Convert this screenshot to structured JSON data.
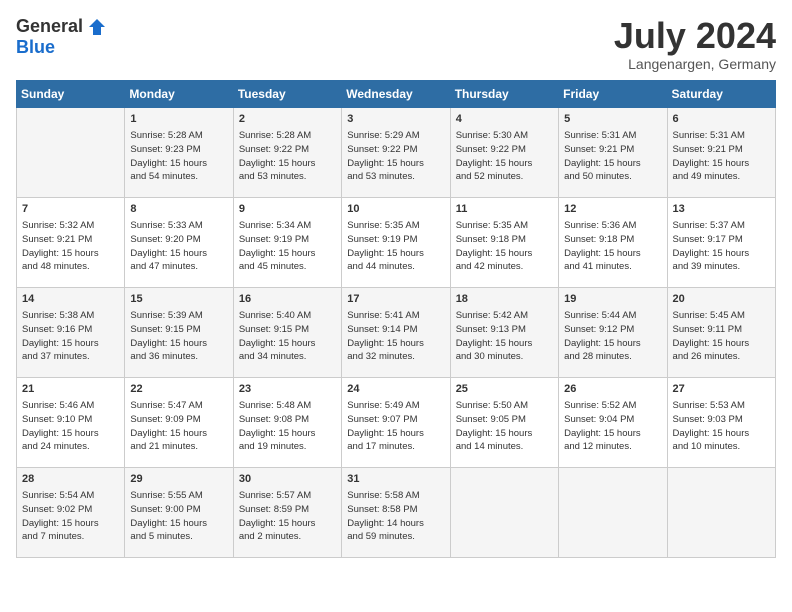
{
  "header": {
    "logo_general": "General",
    "logo_blue": "Blue",
    "month_year": "July 2024",
    "location": "Langenargen, Germany"
  },
  "columns": [
    "Sunday",
    "Monday",
    "Tuesday",
    "Wednesday",
    "Thursday",
    "Friday",
    "Saturday"
  ],
  "weeks": [
    {
      "cells": [
        {
          "day": "",
          "info": ""
        },
        {
          "day": "1",
          "info": "Sunrise: 5:28 AM\nSunset: 9:23 PM\nDaylight: 15 hours\nand 54 minutes."
        },
        {
          "day": "2",
          "info": "Sunrise: 5:28 AM\nSunset: 9:22 PM\nDaylight: 15 hours\nand 53 minutes."
        },
        {
          "day": "3",
          "info": "Sunrise: 5:29 AM\nSunset: 9:22 PM\nDaylight: 15 hours\nand 53 minutes."
        },
        {
          "day": "4",
          "info": "Sunrise: 5:30 AM\nSunset: 9:22 PM\nDaylight: 15 hours\nand 52 minutes."
        },
        {
          "day": "5",
          "info": "Sunrise: 5:31 AM\nSunset: 9:21 PM\nDaylight: 15 hours\nand 50 minutes."
        },
        {
          "day": "6",
          "info": "Sunrise: 5:31 AM\nSunset: 9:21 PM\nDaylight: 15 hours\nand 49 minutes."
        }
      ]
    },
    {
      "cells": [
        {
          "day": "7",
          "info": "Sunrise: 5:32 AM\nSunset: 9:21 PM\nDaylight: 15 hours\nand 48 minutes."
        },
        {
          "day": "8",
          "info": "Sunrise: 5:33 AM\nSunset: 9:20 PM\nDaylight: 15 hours\nand 47 minutes."
        },
        {
          "day": "9",
          "info": "Sunrise: 5:34 AM\nSunset: 9:19 PM\nDaylight: 15 hours\nand 45 minutes."
        },
        {
          "day": "10",
          "info": "Sunrise: 5:35 AM\nSunset: 9:19 PM\nDaylight: 15 hours\nand 44 minutes."
        },
        {
          "day": "11",
          "info": "Sunrise: 5:35 AM\nSunset: 9:18 PM\nDaylight: 15 hours\nand 42 minutes."
        },
        {
          "day": "12",
          "info": "Sunrise: 5:36 AM\nSunset: 9:18 PM\nDaylight: 15 hours\nand 41 minutes."
        },
        {
          "day": "13",
          "info": "Sunrise: 5:37 AM\nSunset: 9:17 PM\nDaylight: 15 hours\nand 39 minutes."
        }
      ]
    },
    {
      "cells": [
        {
          "day": "14",
          "info": "Sunrise: 5:38 AM\nSunset: 9:16 PM\nDaylight: 15 hours\nand 37 minutes."
        },
        {
          "day": "15",
          "info": "Sunrise: 5:39 AM\nSunset: 9:15 PM\nDaylight: 15 hours\nand 36 minutes."
        },
        {
          "day": "16",
          "info": "Sunrise: 5:40 AM\nSunset: 9:15 PM\nDaylight: 15 hours\nand 34 minutes."
        },
        {
          "day": "17",
          "info": "Sunrise: 5:41 AM\nSunset: 9:14 PM\nDaylight: 15 hours\nand 32 minutes."
        },
        {
          "day": "18",
          "info": "Sunrise: 5:42 AM\nSunset: 9:13 PM\nDaylight: 15 hours\nand 30 minutes."
        },
        {
          "day": "19",
          "info": "Sunrise: 5:44 AM\nSunset: 9:12 PM\nDaylight: 15 hours\nand 28 minutes."
        },
        {
          "day": "20",
          "info": "Sunrise: 5:45 AM\nSunset: 9:11 PM\nDaylight: 15 hours\nand 26 minutes."
        }
      ]
    },
    {
      "cells": [
        {
          "day": "21",
          "info": "Sunrise: 5:46 AM\nSunset: 9:10 PM\nDaylight: 15 hours\nand 24 minutes."
        },
        {
          "day": "22",
          "info": "Sunrise: 5:47 AM\nSunset: 9:09 PM\nDaylight: 15 hours\nand 21 minutes."
        },
        {
          "day": "23",
          "info": "Sunrise: 5:48 AM\nSunset: 9:08 PM\nDaylight: 15 hours\nand 19 minutes."
        },
        {
          "day": "24",
          "info": "Sunrise: 5:49 AM\nSunset: 9:07 PM\nDaylight: 15 hours\nand 17 minutes."
        },
        {
          "day": "25",
          "info": "Sunrise: 5:50 AM\nSunset: 9:05 PM\nDaylight: 15 hours\nand 14 minutes."
        },
        {
          "day": "26",
          "info": "Sunrise: 5:52 AM\nSunset: 9:04 PM\nDaylight: 15 hours\nand 12 minutes."
        },
        {
          "day": "27",
          "info": "Sunrise: 5:53 AM\nSunset: 9:03 PM\nDaylight: 15 hours\nand 10 minutes."
        }
      ]
    },
    {
      "cells": [
        {
          "day": "28",
          "info": "Sunrise: 5:54 AM\nSunset: 9:02 PM\nDaylight: 15 hours\nand 7 minutes."
        },
        {
          "day": "29",
          "info": "Sunrise: 5:55 AM\nSunset: 9:00 PM\nDaylight: 15 hours\nand 5 minutes."
        },
        {
          "day": "30",
          "info": "Sunrise: 5:57 AM\nSunset: 8:59 PM\nDaylight: 15 hours\nand 2 minutes."
        },
        {
          "day": "31",
          "info": "Sunrise: 5:58 AM\nSunset: 8:58 PM\nDaylight: 14 hours\nand 59 minutes."
        },
        {
          "day": "",
          "info": ""
        },
        {
          "day": "",
          "info": ""
        },
        {
          "day": "",
          "info": ""
        }
      ]
    }
  ]
}
